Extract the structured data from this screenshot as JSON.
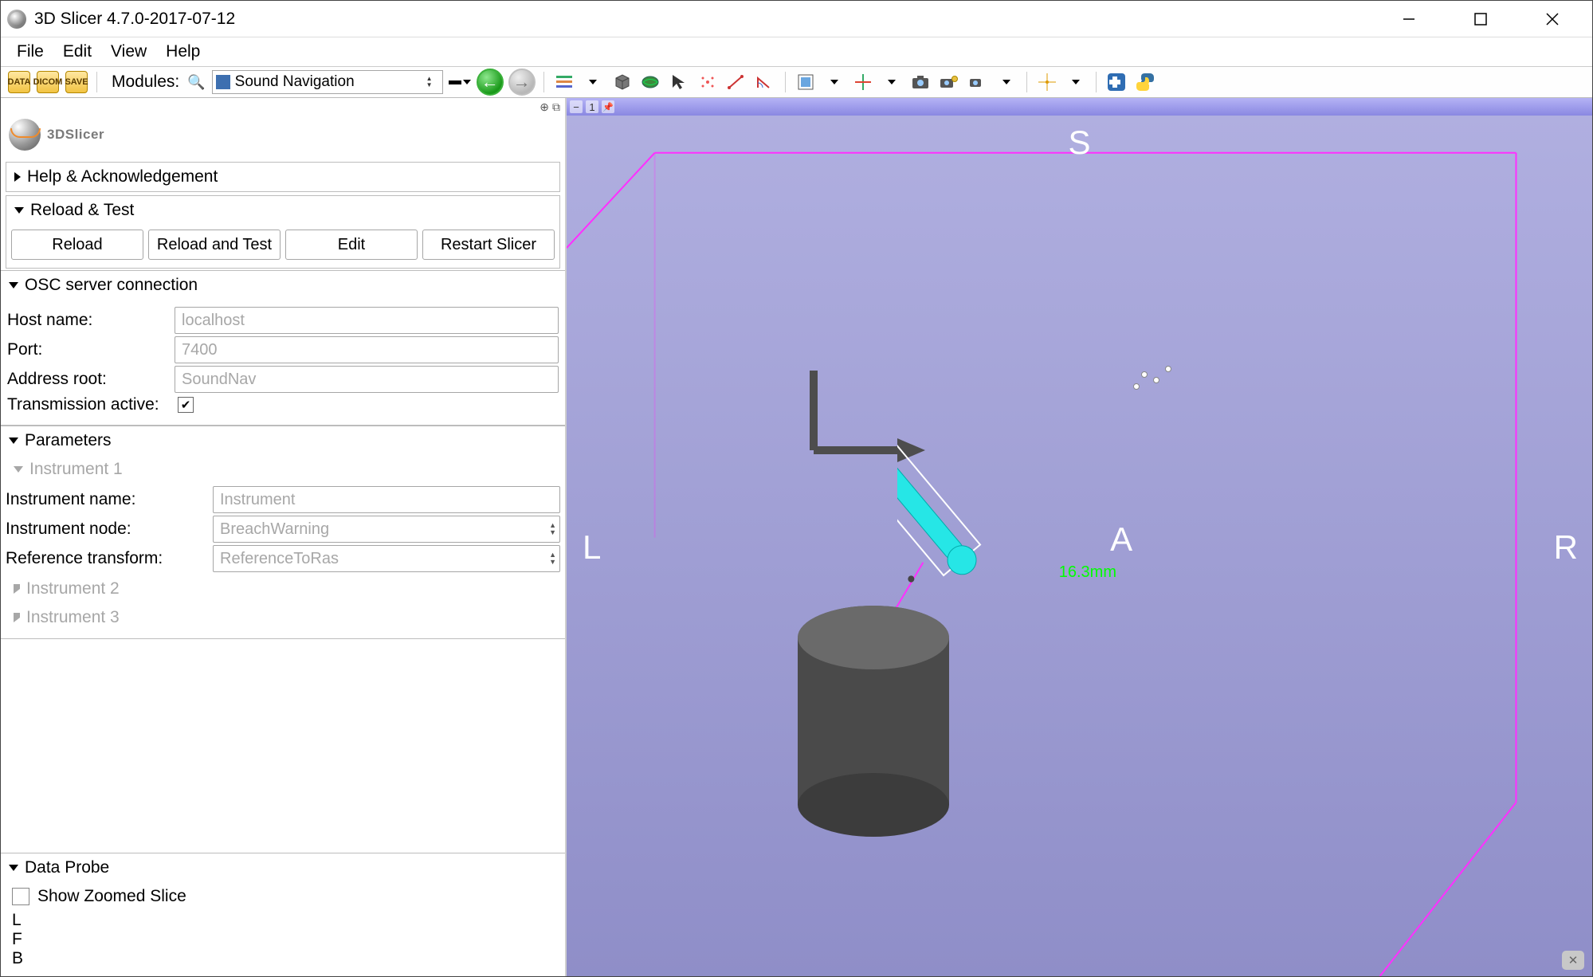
{
  "window": {
    "title": "3D Slicer 4.7.0-2017-07-12"
  },
  "menu": {
    "file": "File",
    "edit": "Edit",
    "view": "View",
    "help": "Help"
  },
  "toolbar": {
    "data": "DATA",
    "dicom": "DICOM",
    "save": "SAVE",
    "modules_label": "Modules:",
    "current_module": "Sound Navigation"
  },
  "panel": {
    "logo": "3DSlicer",
    "help_ack": "Help & Acknowledgement",
    "reload_test": {
      "header": "Reload & Test",
      "reload": "Reload",
      "reload_and_test": "Reload and Test",
      "edit": "Edit",
      "restart": "Restart Slicer"
    },
    "osc": {
      "header": "OSC server connection",
      "host_label": "Host name:",
      "host_value": "localhost",
      "port_label": "Port:",
      "port_value": "7400",
      "addr_label": "Address root:",
      "addr_value": "SoundNav",
      "tx_label": "Transmission active:"
    },
    "params": {
      "header": "Parameters",
      "inst1": "Instrument 1",
      "name_label": "Instrument name:",
      "name_value": "Instrument",
      "node_label": "Instrument node:",
      "node_value": "BreachWarning",
      "ref_label": "Reference transform:",
      "ref_value": "ReferenceToRas",
      "inst2": "Instrument 2",
      "inst3": "Instrument 3"
    },
    "dataprobe": {
      "header": "Data Probe",
      "show_zoomed": "Show Zoomed Slice",
      "L": "L",
      "F": "F",
      "B": "B"
    }
  },
  "view": {
    "tab_number": "1",
    "S": "S",
    "A": "A",
    "L": "L",
    "R": "R",
    "measurement": "16.3mm"
  }
}
